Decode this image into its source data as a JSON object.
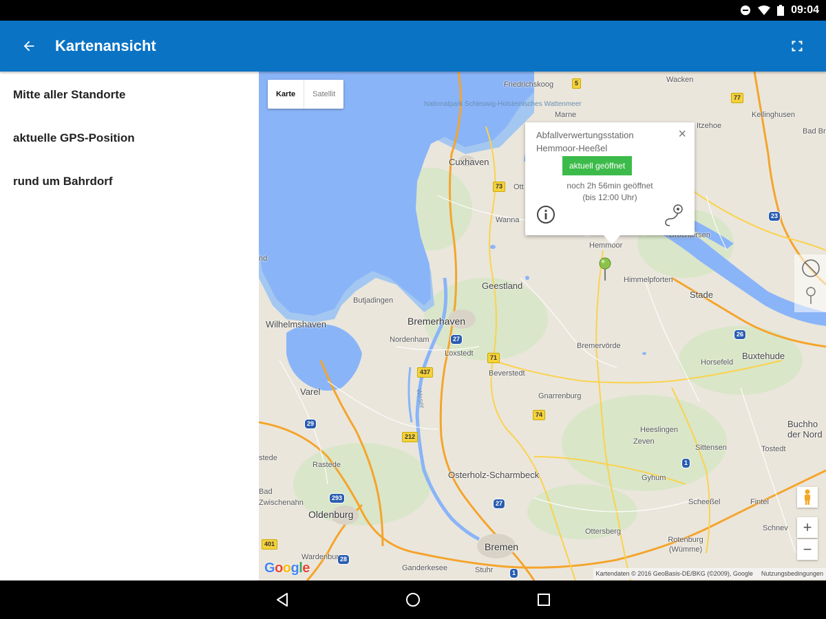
{
  "status_bar": {
    "time": "09:04",
    "icons": [
      "minus-circle-icon",
      "wifi-icon",
      "battery-icon"
    ]
  },
  "app_bar": {
    "title": "Kartenansicht",
    "back_icon": "arrow-back-icon",
    "fullscreen_icon": "fullscreen-icon",
    "color": "#0a73c4"
  },
  "sidebar": {
    "items": [
      {
        "label": "Mitte aller Standorte"
      },
      {
        "label": "aktuelle GPS-Position"
      },
      {
        "label": "rund um Bahrdorf"
      }
    ]
  },
  "map": {
    "type_control": {
      "map_label": "Karte",
      "satellite_label": "Satellit",
      "selected": "Karte"
    },
    "info_window": {
      "title": "Abfallverwertungsstation Hemmoor-Heeßel",
      "status": "aktuell geöffnet",
      "status_color": "#3dbb4a",
      "hours_line1": "noch 2h 56min geöffnet",
      "hours_line2": "(bis 12:00 Uhr)",
      "close_icon": "close-icon",
      "info_icon": "info-icon",
      "route_icon": "route-icon"
    },
    "marker_color": "#8bc34a",
    "labels": {
      "friedrichskoog": "Friedrichskoog",
      "wacken": "Wacken",
      "nationalpark": "Nationalpark Schleswig-Holsteinisches Wattenmeer",
      "marne": "Marne",
      "itzehoe": "Itzehoe",
      "kellinghusen": "Kellinghusen",
      "bad_bramstedt": "Bad Bra",
      "cuxhaven": "Cuxhaven",
      "otterndorf": "Ott",
      "wanna": "Wanna",
      "drochtersen": "Drochtersen",
      "hemmoor": "Hemmoor",
      "himmelpforten": "Himmelpforten",
      "geestland": "Geestland",
      "stade": "Stade",
      "butjadingen": "Butjadingen",
      "bremerhaven": "Bremerhaven",
      "wilhelmshaven": "Wilhelmshaven",
      "nordenham": "Nordenham",
      "loxstedt": "Loxstedt",
      "bremervoerde": "Bremervörde",
      "horneburg": "Horsefeld",
      "buxtehude": "Buxtehude",
      "beverstedt": "Beverstedt",
      "varel": "Varel",
      "gnarrenburg": "Gnarrenburg",
      "buchholz": "Buchho der Nord",
      "heeslingen": "Heeslingen",
      "zeven": "Zeven",
      "sittensen": "Sittensen",
      "tostedt": "Tostedt",
      "rastede": "Rastede",
      "osterholz": "Osterholz-Scharmbeck",
      "gyhum": "Gyhum",
      "bad_zwischenahn": "Bad Zwischenahn",
      "scheessel": "Scheeßel",
      "fintel": "Fintel",
      "oldenburg": "Oldenburg",
      "schneverdingen": "Schnev",
      "ottersberg": "Ottersberg",
      "bremen": "Bremen",
      "rotenburg": "Rotenburg (Wümme)",
      "wardenburg": "Wardenburg",
      "ganderkesee": "Ganderkesee",
      "stuhr": "Stuhr",
      "weser": "Weser",
      "stede": "stede",
      "nd": "nd"
    },
    "shields": {
      "s5": "5",
      "s77": "77",
      "s73": "73",
      "s23": "23",
      "s27a": "27",
      "s71": "71",
      "s26": "26",
      "s437": "437",
      "s29": "29",
      "s212": "212",
      "s74": "74",
      "s1a": "1",
      "s293": "293",
      "s27b": "27",
      "s401": "401",
      "s1b": "1",
      "s28": "28"
    },
    "controls": {
      "zoom_in": "+",
      "zoom_out": "−",
      "pegman_icon": "pegman-icon",
      "compass_icon": "compass-icon",
      "pin_icon": "location-pin-icon"
    },
    "google_logo": "Google",
    "attribution": "Kartendaten © 2016 GeoBasis-DE/BKG (©2009), Google",
    "terms": "Nutzungsbedingungen"
  },
  "nav_bar": {
    "back_icon": "nav-back-icon",
    "home_icon": "nav-home-icon",
    "recents_icon": "nav-recents-icon"
  }
}
